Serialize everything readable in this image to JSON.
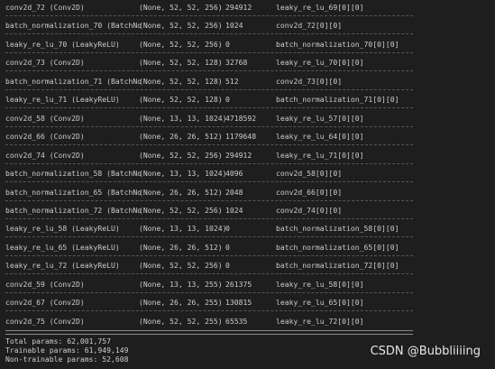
{
  "rows": [
    {
      "layer": "conv2d_72 (Conv2D)",
      "shape": "(None, 52, 52, 256)",
      "params": "294912",
      "connected": "leaky_re_lu_69[0][0]"
    },
    {
      "layer": "batch_normalization_70 (BatchNo",
      "shape": "(None, 52, 52, 256)",
      "params": "1024",
      "connected": "conv2d_72[0][0]"
    },
    {
      "layer": "leaky_re_lu_70 (LeakyReLU)",
      "shape": "(None, 52, 52, 256)",
      "params": "0",
      "connected": "batch_normalization_70[0][0]"
    },
    {
      "layer": "conv2d_73 (Conv2D)",
      "shape": "(None, 52, 52, 128)",
      "params": "32768",
      "connected": "leaky_re_lu_70[0][0]"
    },
    {
      "layer": "batch_normalization_71 (BatchNo",
      "shape": "(None, 52, 52, 128)",
      "params": "512",
      "connected": "conv2d_73[0][0]"
    },
    {
      "layer": "leaky_re_lu_71 (LeakyReLU)",
      "shape": "(None, 52, 52, 128)",
      "params": "0",
      "connected": "batch_normalization_71[0][0]"
    },
    {
      "layer": "conv2d_58 (Conv2D)",
      "shape": "(None, 13, 13, 1024)",
      "params": "4718592",
      "connected": "leaky_re_lu_57[0][0]"
    },
    {
      "layer": "conv2d_66 (Conv2D)",
      "shape": "(None, 26, 26, 512)",
      "params": "1179648",
      "connected": "leaky_re_lu_64[0][0]"
    },
    {
      "layer": "conv2d_74 (Conv2D)",
      "shape": "(None, 52, 52, 256)",
      "params": "294912",
      "connected": "leaky_re_lu_71[0][0]"
    },
    {
      "layer": "batch_normalization_58 (BatchNo",
      "shape": "(None, 13, 13, 1024)",
      "params": "4096",
      "connected": "conv2d_58[0][0]"
    },
    {
      "layer": "batch_normalization_65 (BatchNo",
      "shape": "(None, 26, 26, 512)",
      "params": "2048",
      "connected": "conv2d_66[0][0]"
    },
    {
      "layer": "batch_normalization_72 (BatchNo",
      "shape": "(None, 52, 52, 256)",
      "params": "1024",
      "connected": "conv2d_74[0][0]"
    },
    {
      "layer": "leaky_re_lu_58 (LeakyReLU)",
      "shape": "(None, 13, 13, 1024)",
      "params": "0",
      "connected": "batch_normalization_58[0][0]"
    },
    {
      "layer": "leaky_re_lu_65 (LeakyReLU)",
      "shape": "(None, 26, 26, 512)",
      "params": "0",
      "connected": "batch_normalization_65[0][0]"
    },
    {
      "layer": "leaky_re_lu_72 (LeakyReLU)",
      "shape": "(None, 52, 52, 256)",
      "params": "0",
      "connected": "batch_normalization_72[0][0]"
    },
    {
      "layer": "conv2d_59 (Conv2D)",
      "shape": "(None, 13, 13, 255)",
      "params": "261375",
      "connected": "leaky_re_lu_58[0][0]"
    },
    {
      "layer": "conv2d_67 (Conv2D)",
      "shape": "(None, 26, 26, 255)",
      "params": "130815",
      "connected": "leaky_re_lu_65[0][0]"
    },
    {
      "layer": "conv2d_75 (Conv2D)",
      "shape": "(None, 52, 52, 255)",
      "params": "65535",
      "connected": "leaky_re_lu_72[0][0]"
    }
  ],
  "summary": {
    "total": "Total params: 62,001,757",
    "trainable": "Trainable params: 61,949,149",
    "non_trainable": "Non-trainable params: 52,608"
  },
  "watermark": "CSDN @Bubbliiiing"
}
